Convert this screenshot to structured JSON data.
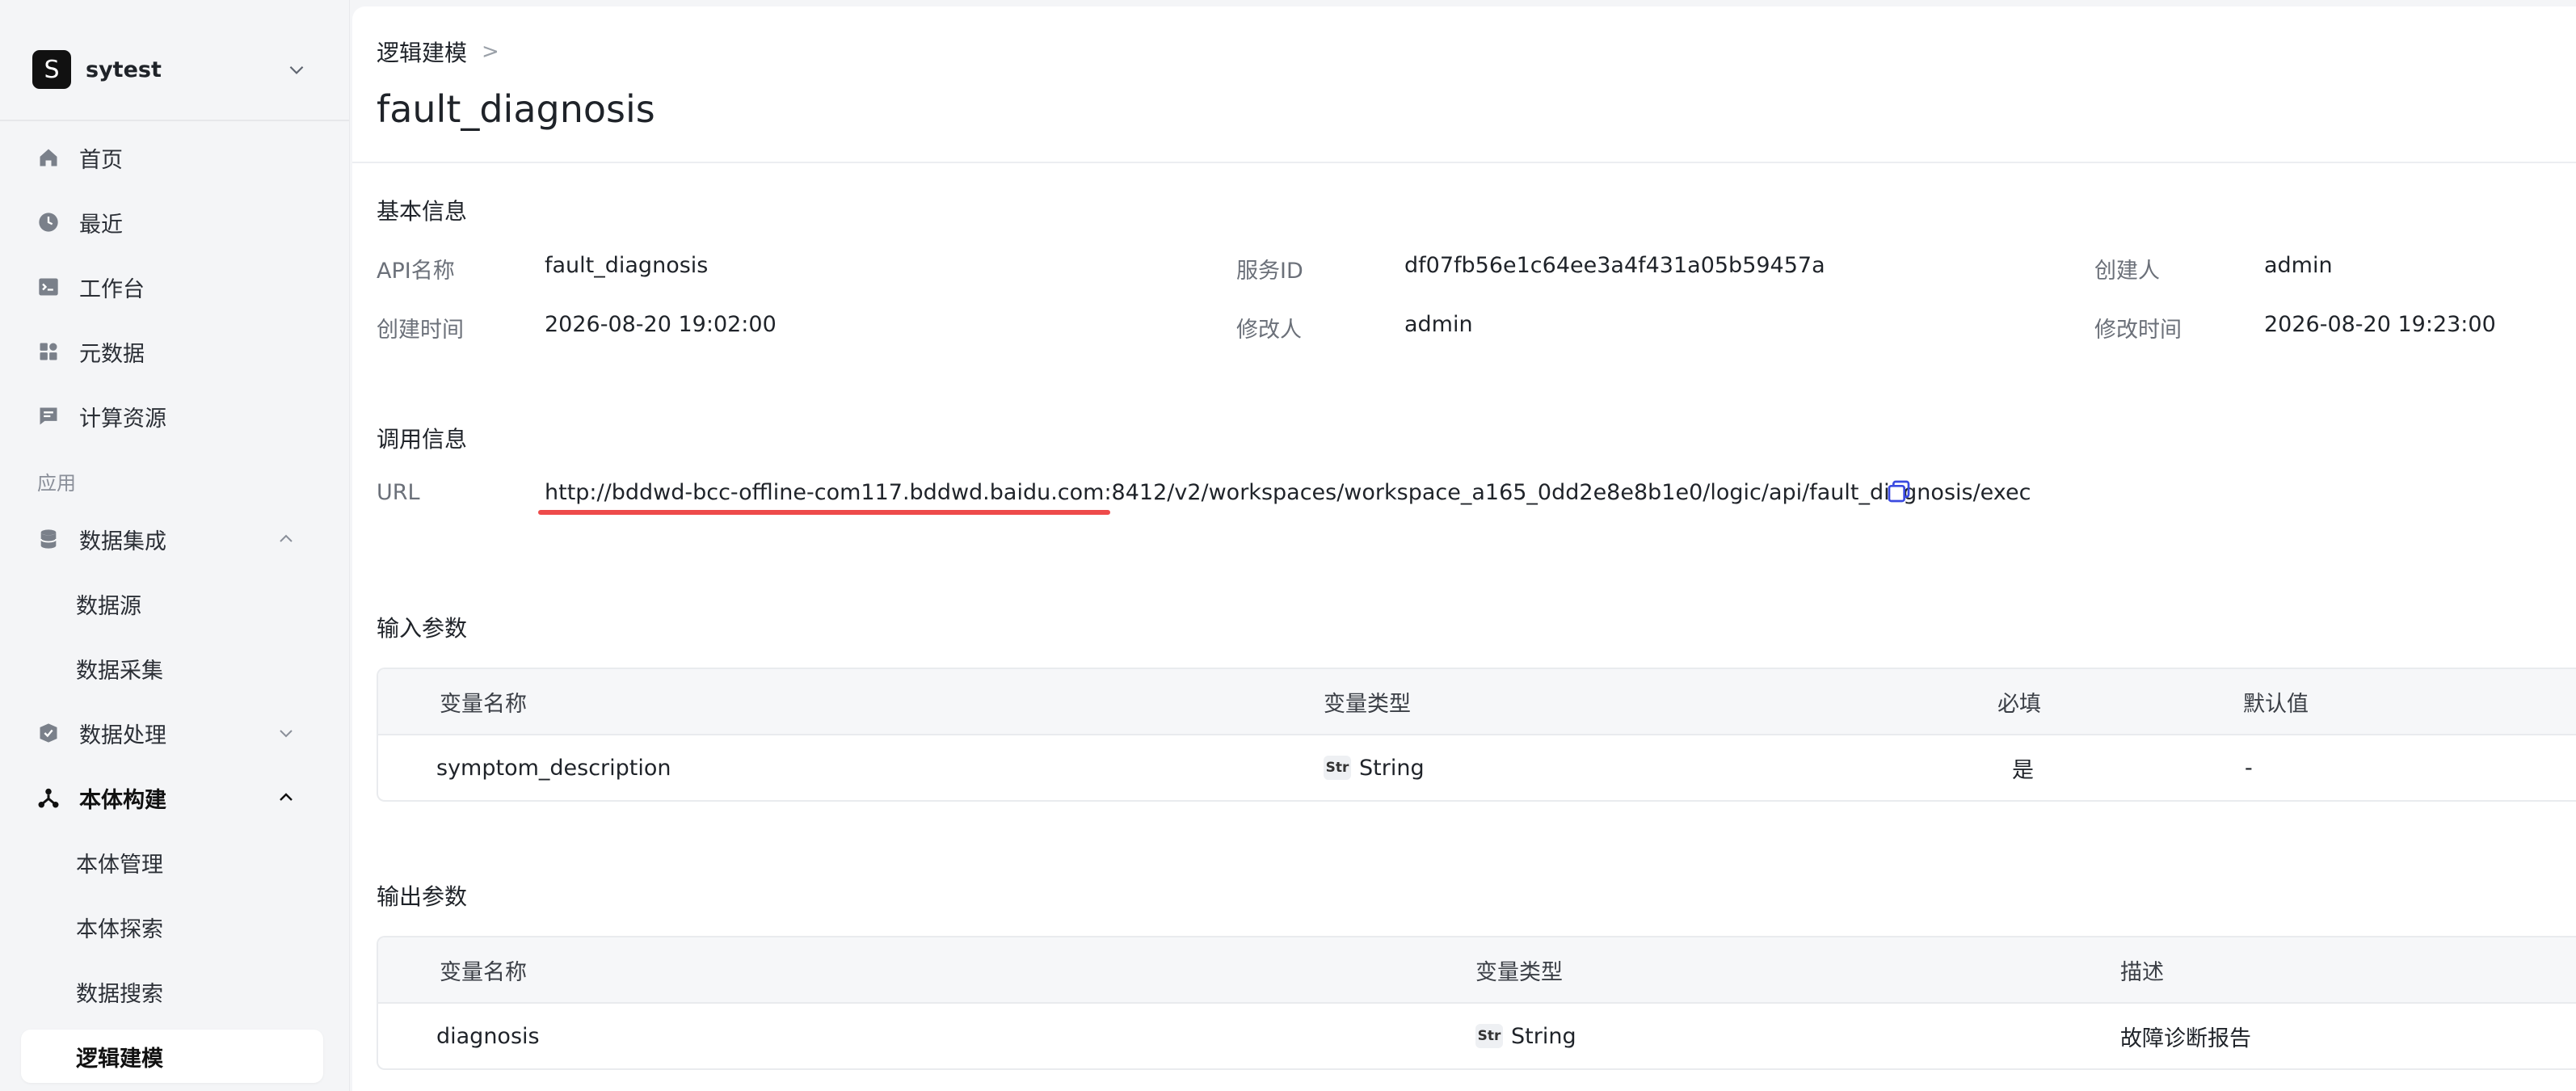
{
  "workspace": {
    "logo_letter": "S",
    "name": "sytest"
  },
  "nav": {
    "home": "首页",
    "recent": "最近",
    "workbench": "工作台",
    "metadata": "元数据",
    "compute": "计算资源",
    "section_apps": "应用",
    "data_integration": "数据集成",
    "data_source": "数据源",
    "data_collection": "数据采集",
    "data_processing": "数据处理",
    "ontology_build": "本体构建",
    "ontology_manage": "本体管理",
    "ontology_explore": "本体探索",
    "data_search": "数据搜索",
    "logic_modeling": "逻辑建模"
  },
  "breadcrumb": {
    "parent": "逻辑建模",
    "separator": ">"
  },
  "page_title": "fault_diagnosis",
  "basic_info": {
    "section_title": "基本信息",
    "api_name_label": "API名称",
    "api_name": "fault_diagnosis",
    "service_id_label": "服务ID",
    "service_id": "df07fb56e1c64ee3a4f431a05b59457a",
    "creator_label": "创建人",
    "creator": "admin",
    "created_time_label": "创建时间",
    "created_time": "2026-08-20 19:02:00",
    "modifier_label": "修改人",
    "modifier": "admin",
    "modified_time_label": "修改时间",
    "modified_time": "2026-08-20 19:23:00"
  },
  "call_info": {
    "section_title": "调用信息",
    "url_label": "URL",
    "url": "http://bddwd-bcc-offline-com117.bddwd.baidu.com:8412/v2/workspaces/workspace_a165_0dd2e8e8b1e0/logic/api/fault_diagnosis/exec",
    "highlight_color": "#ee4b4b"
  },
  "input_params": {
    "section_title": "输入参数",
    "headers": {
      "name": "变量名称",
      "type": "变量类型",
      "required": "必填",
      "default": "默认值"
    },
    "rows": [
      {
        "name": "symptom_description",
        "type_badge": "Str",
        "type": "String",
        "required": "是",
        "default": "-"
      }
    ]
  },
  "output_params": {
    "section_title": "输出参数",
    "headers": {
      "name": "变量名称",
      "type": "变量类型",
      "desc": "描述"
    },
    "rows": [
      {
        "name": "diagnosis",
        "type_badge": "Str",
        "type": "String",
        "desc": "故障诊断报告"
      }
    ]
  },
  "icons": {
    "home": "home-icon",
    "recent": "clock-icon",
    "workbench": "terminal-icon",
    "metadata": "grid-icon",
    "compute": "message-box-icon",
    "data_integration": "database-icon",
    "data_processing": "process-icon",
    "ontology_build": "graph-nodes-icon",
    "copy": "copy-icon"
  }
}
